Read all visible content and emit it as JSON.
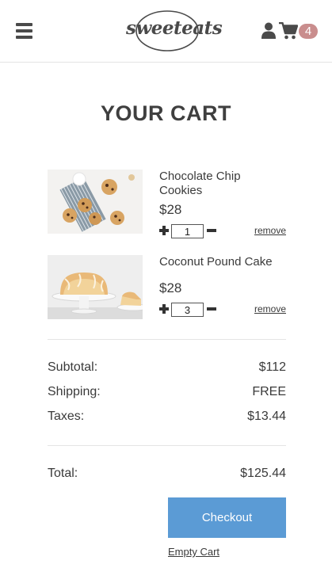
{
  "header": {
    "logo_text": "sweeteats",
    "cart_count": "4",
    "icons": {
      "menu": "hamburger-menu-icon",
      "user": "user-icon",
      "cart": "shopping-cart-icon"
    }
  },
  "cart": {
    "title": "YOUR CART",
    "items": [
      {
        "name": "Chocolate Chip Cookies",
        "price": "$28",
        "quantity": "1",
        "remove_label": "remove",
        "image": "cookies-photo"
      },
      {
        "name": "Coconut Pound Cake",
        "price": "$28",
        "quantity": "3",
        "remove_label": "remove",
        "image": "pound-cake-photo"
      }
    ]
  },
  "summary": {
    "subtotal_label": "Subtotal:",
    "subtotal_value": "$112",
    "shipping_label": "Shipping:",
    "shipping_value": "FREE",
    "taxes_label": "Taxes:",
    "taxes_value": "$13.44",
    "total_label": "Total:",
    "total_value": "$125.44"
  },
  "actions": {
    "checkout_label": "Checkout",
    "empty_cart_label": "Empty Cart"
  },
  "colors": {
    "accent": "#5b9bd5",
    "badge": "#c98d8d",
    "text": "#3a3a3a"
  }
}
